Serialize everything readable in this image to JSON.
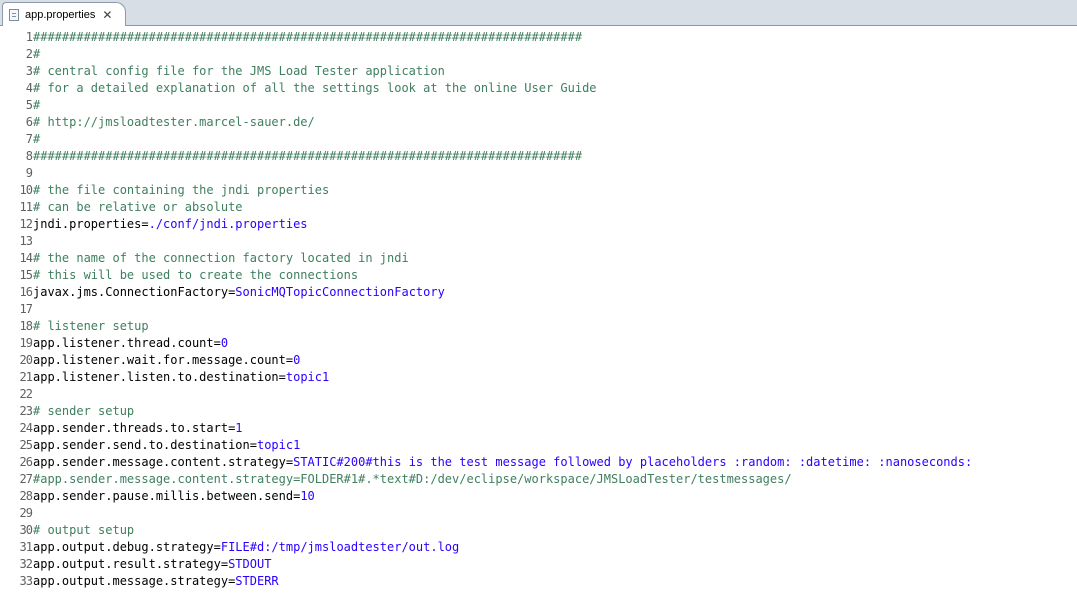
{
  "tab": {
    "title": "app.properties",
    "close_glyph": "✕"
  },
  "colors": {
    "comment": "#3f7f5f",
    "key": "#000000",
    "value": "#2a00ff",
    "line_number": "#606060"
  },
  "lines": [
    {
      "n": "1",
      "type": "comment",
      "text": "############################################################################"
    },
    {
      "n": "2",
      "type": "comment",
      "text": "#"
    },
    {
      "n": "3",
      "type": "comment",
      "text": "# central config file for the JMS Load Tester application"
    },
    {
      "n": "4",
      "type": "comment",
      "text": "# for a detailed explanation of all the settings look at the online User Guide"
    },
    {
      "n": "5",
      "type": "comment",
      "text": "#"
    },
    {
      "n": "6",
      "type": "comment",
      "text": "# http://jmsloadtester.marcel-sauer.de/"
    },
    {
      "n": "7",
      "type": "comment",
      "text": "#"
    },
    {
      "n": "8",
      "type": "comment",
      "text": "############################################################################"
    },
    {
      "n": "9",
      "type": "empty",
      "text": ""
    },
    {
      "n": "10",
      "type": "comment",
      "text": "# the file containing the jndi properties"
    },
    {
      "n": "11",
      "type": "comment",
      "text": "# can be relative or absolute"
    },
    {
      "n": "12",
      "type": "prop",
      "key": "jndi.properties=",
      "value": "./conf/jndi.properties"
    },
    {
      "n": "13",
      "type": "empty",
      "text": ""
    },
    {
      "n": "14",
      "type": "comment",
      "text": "# the name of the connection factory located in jndi"
    },
    {
      "n": "15",
      "type": "comment",
      "text": "# this will be used to create the connections"
    },
    {
      "n": "16",
      "type": "prop",
      "key": "javax.jms.ConnectionFactory=",
      "value": "SonicMQTopicConnectionFactory"
    },
    {
      "n": "17",
      "type": "empty",
      "text": ""
    },
    {
      "n": "18",
      "type": "comment",
      "text": "# listener setup"
    },
    {
      "n": "19",
      "type": "prop",
      "key": "app.listener.thread.count=",
      "value": "0"
    },
    {
      "n": "20",
      "type": "prop",
      "key": "app.listener.wait.for.message.count=",
      "value": "0"
    },
    {
      "n": "21",
      "type": "prop",
      "key": "app.listener.listen.to.destination=",
      "value": "topic1"
    },
    {
      "n": "22",
      "type": "empty",
      "text": ""
    },
    {
      "n": "23",
      "type": "comment",
      "text": "# sender setup"
    },
    {
      "n": "24",
      "type": "prop",
      "key": "app.sender.threads.to.start=",
      "value": "1"
    },
    {
      "n": "25",
      "type": "prop",
      "key": "app.sender.send.to.destination=",
      "value": "topic1"
    },
    {
      "n": "26",
      "type": "prop",
      "key": "app.sender.message.content.strategy=",
      "value": "STATIC#200#this is the test message followed by placeholders :random: :datetime: :nanoseconds:"
    },
    {
      "n": "27",
      "type": "comment",
      "text": "#app.sender.message.content.strategy=FOLDER#1#.*text#D:/dev/eclipse/workspace/JMSLoadTester/testmessages/"
    },
    {
      "n": "28",
      "type": "prop",
      "key": "app.sender.pause.millis.between.send=",
      "value": "10"
    },
    {
      "n": "29",
      "type": "empty",
      "text": ""
    },
    {
      "n": "30",
      "type": "comment",
      "text": "# output setup"
    },
    {
      "n": "31",
      "type": "prop",
      "key": "app.output.debug.strategy=",
      "value": "FILE#d:/tmp/jmsloadtester/out.log"
    },
    {
      "n": "32",
      "type": "prop",
      "key": "app.output.result.strategy=",
      "value": "STDOUT"
    },
    {
      "n": "33",
      "type": "prop",
      "key": "app.output.message.strategy=",
      "value": "STDERR"
    }
  ]
}
